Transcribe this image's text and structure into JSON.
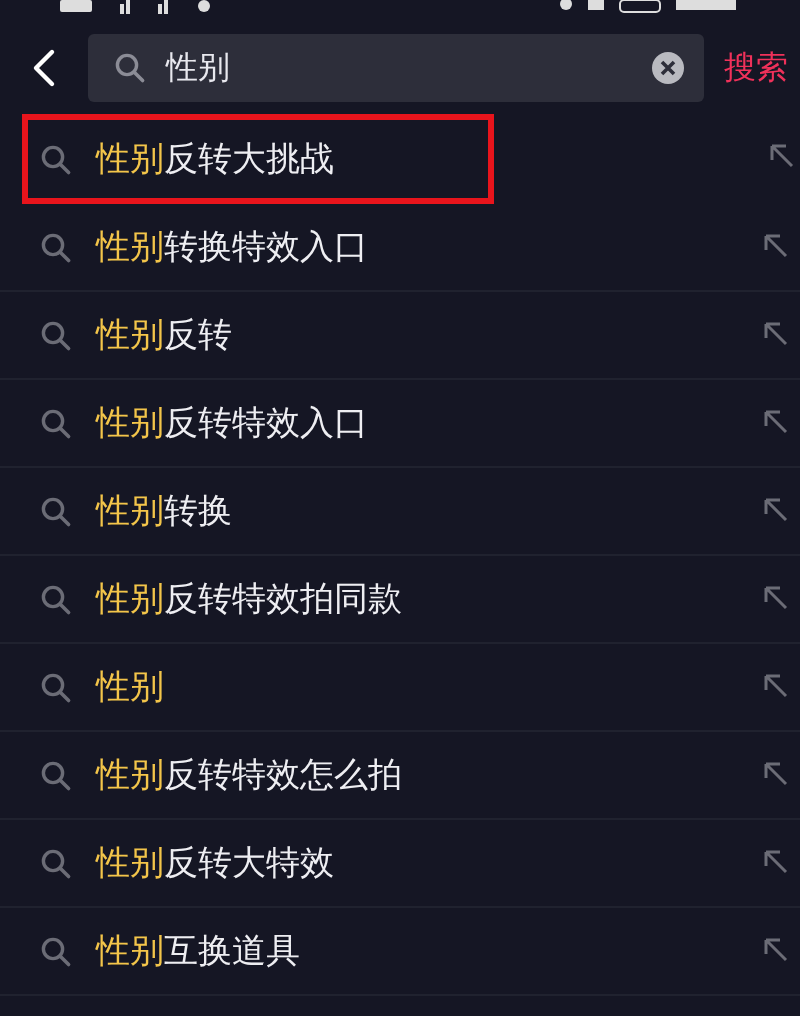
{
  "search": {
    "value": "性别",
    "button": "搜索"
  },
  "suggestions": [
    {
      "highlight": "性别",
      "rest": "反转大挑战",
      "selected": true
    },
    {
      "highlight": "性别",
      "rest": "转换特效入口",
      "selected": false
    },
    {
      "highlight": "性别",
      "rest": "反转",
      "selected": false
    },
    {
      "highlight": "性别",
      "rest": "反转特效入口",
      "selected": false
    },
    {
      "highlight": "性别",
      "rest": "转换",
      "selected": false
    },
    {
      "highlight": "性别",
      "rest": "反转特效拍同款",
      "selected": false
    },
    {
      "highlight": "性别",
      "selected": false
    },
    {
      "highlight": "性别",
      "rest": "反转特效怎么拍",
      "selected": false
    },
    {
      "highlight": "性别",
      "rest": "反转大特效",
      "selected": false
    },
    {
      "highlight": "性别",
      "rest": "互换道具",
      "selected": false
    }
  ]
}
